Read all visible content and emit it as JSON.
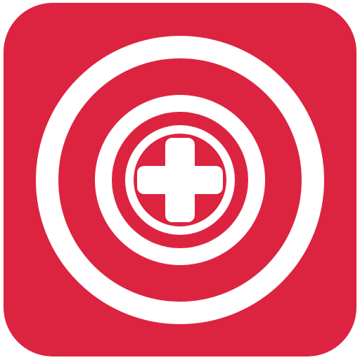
{
  "app_icon": {
    "label": "",
    "icon": "target-medical-cross-icon",
    "colors": {
      "background": "#DC2440",
      "rings": "#FFFFFF",
      "cross": "#FFFFFF"
    }
  }
}
